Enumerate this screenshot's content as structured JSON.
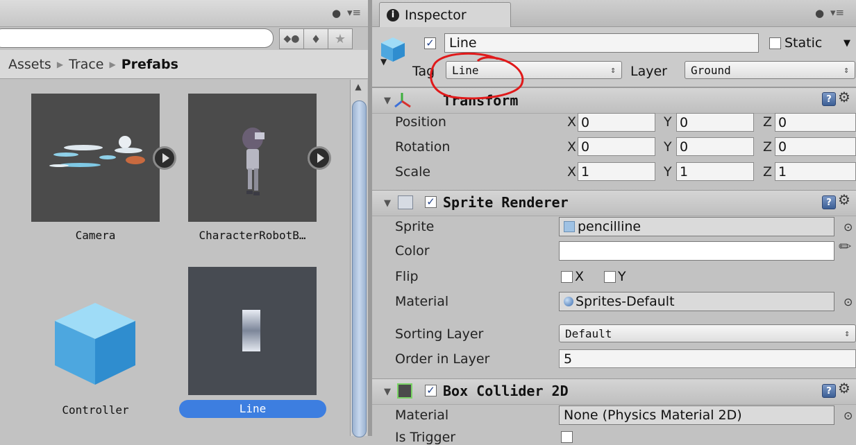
{
  "project": {
    "breadcrumb": [
      "Assets",
      "Trace",
      "Prefabs"
    ],
    "assets": [
      {
        "name": "Camera"
      },
      {
        "name": "CharacterRobotB…"
      },
      {
        "name": "Controller"
      },
      {
        "name": "Line",
        "selected": true
      }
    ]
  },
  "inspector": {
    "tab_label": "Inspector",
    "object_name": "Line",
    "active": true,
    "static_label": "Static",
    "tag_label": "Tag",
    "tag_value": "Line",
    "layer_label": "Layer",
    "layer_value": "Ground",
    "transform": {
      "title": "Transform",
      "rows": [
        {
          "label": "Position",
          "x": "0",
          "y": "0",
          "z": "0"
        },
        {
          "label": "Rotation",
          "x": "0",
          "y": "0",
          "z": "0"
        },
        {
          "label": "Scale",
          "x": "1",
          "y": "1",
          "z": "1"
        }
      ],
      "axis_x": "X",
      "axis_y": "Y",
      "axis_z": "Z"
    },
    "sprite_renderer": {
      "title": "Sprite Renderer",
      "sprite_label": "Sprite",
      "sprite_value": "pencilline",
      "color_label": "Color",
      "flip_label": "Flip",
      "flip_x": "X",
      "flip_y": "Y",
      "material_label": "Material",
      "material_value": "Sprites-Default",
      "sorting_layer_label": "Sorting Layer",
      "sorting_layer_value": "Default",
      "order_label": "Order in Layer",
      "order_value": "5"
    },
    "box_collider": {
      "title": "Box Collider 2D",
      "material_label": "Material",
      "material_value": "None (Physics Material 2D)",
      "is_trigger_label": "Is Trigger"
    }
  },
  "colors": {
    "selection": "#3d7ee0",
    "annotation_red": "#e0191a",
    "panel_bg": "#c2c2c2"
  }
}
